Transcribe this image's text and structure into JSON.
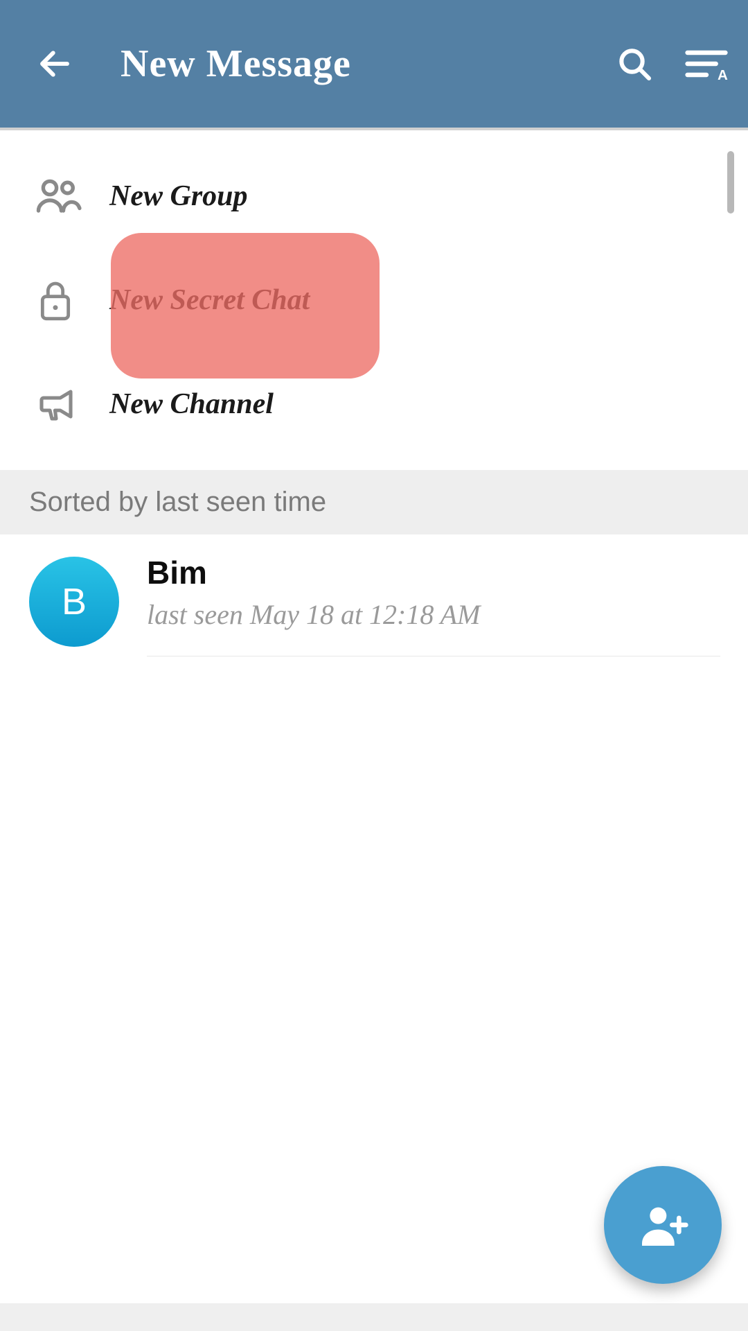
{
  "header": {
    "title": "New Message"
  },
  "options": [
    {
      "icon": "people",
      "label": "New Group"
    },
    {
      "icon": "lock",
      "label": "New Secret Chat"
    },
    {
      "icon": "megaphone",
      "label": "New Channel"
    }
  ],
  "sort_header": "Sorted by last seen time",
  "contacts": [
    {
      "initial": "B",
      "name": "Bim",
      "status": "last seen May 18 at 12:18 AM"
    }
  ],
  "colors": {
    "header_bg": "#5480a4",
    "highlight": "#ed6d65",
    "fab": "#4a9fd0",
    "avatar_gradient_top": "#29c3e6",
    "avatar_gradient_bottom": "#0d9bcf"
  }
}
